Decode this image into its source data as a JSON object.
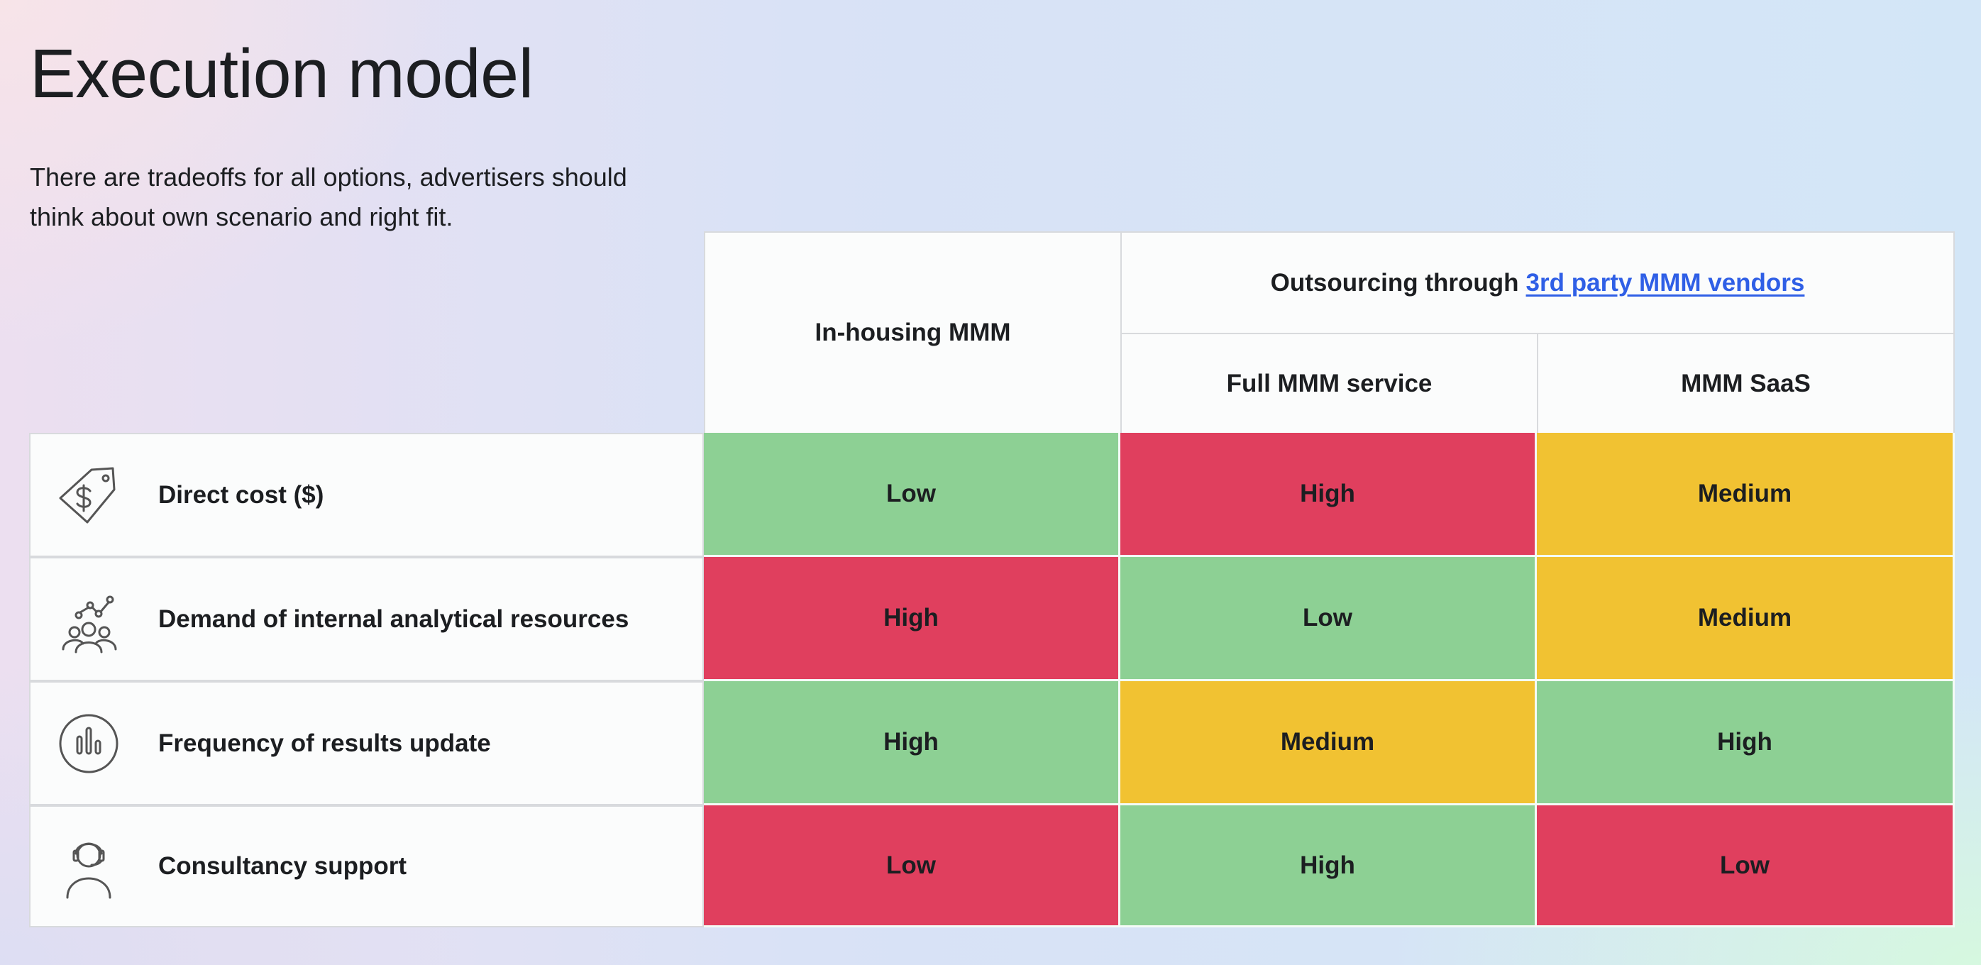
{
  "page": {
    "title": "Execution model",
    "subtitle": "There are tradeoffs for all options, advertisers should think about own scenario and right fit."
  },
  "colors": {
    "low_good": "#8dd094",
    "high_bad": "#e03f5e",
    "medium": "#f1c232",
    "link": "#2f5fe6"
  },
  "table": {
    "headers": {
      "inhouse": "In-housing MMM",
      "outsourcing_prefix": "Outsourcing through",
      "outsourcing_link": "3rd party MMM vendors",
      "full_service": "Full MMM service",
      "saas": "MMM SaaS"
    },
    "rows": [
      {
        "icon": "price-tag-dollar-icon",
        "label": "Direct cost ($)",
        "values": [
          {
            "text": "Low",
            "rating": "good"
          },
          {
            "text": "High",
            "rating": "bad"
          },
          {
            "text": "Medium",
            "rating": "medium"
          }
        ]
      },
      {
        "icon": "team-analytics-icon",
        "label": "Demand of internal analytical resources",
        "values": [
          {
            "text": "High",
            "rating": "bad"
          },
          {
            "text": "Low",
            "rating": "good"
          },
          {
            "text": "Medium",
            "rating": "medium"
          }
        ]
      },
      {
        "icon": "bar-chart-circle-icon",
        "label": "Frequency of results update",
        "values": [
          {
            "text": "High",
            "rating": "good"
          },
          {
            "text": "Medium",
            "rating": "medium"
          },
          {
            "text": "High",
            "rating": "good"
          }
        ]
      },
      {
        "icon": "headset-support-icon",
        "label": "Consultancy support",
        "values": [
          {
            "text": "Low",
            "rating": "bad"
          },
          {
            "text": "High",
            "rating": "good"
          },
          {
            "text": "Low",
            "rating": "bad"
          }
        ]
      }
    ]
  }
}
